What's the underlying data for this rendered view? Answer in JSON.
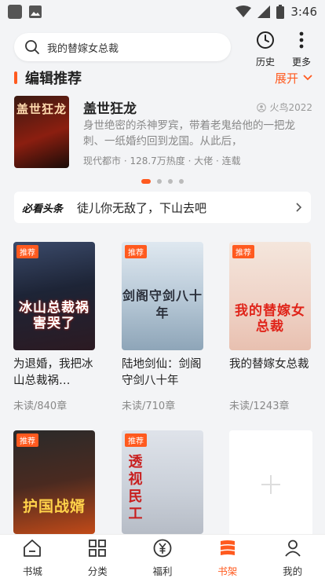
{
  "status_bar": {
    "time": "3:46"
  },
  "search": {
    "placeholder": "我的替嫁女总裁"
  },
  "top_actions": {
    "history": "历史",
    "more": "更多"
  },
  "section": {
    "title": "编辑推荐",
    "expand": "展开"
  },
  "featured": {
    "title": "盖世狂龙",
    "author": "火鸟2022",
    "description": "身世绝密的杀神罗宾，带着老鬼给他的一把龙刺、一纸婚约回到龙国。从此后，",
    "meta": "现代都市 · 128.7万热度 · 大佬 · 连载",
    "cover_text": "盖世狂龙"
  },
  "carousel": {
    "count": 4,
    "active": 0
  },
  "headline": {
    "brand": "必看头条",
    "text": "徒儿你无敌了，下山去吧"
  },
  "books": [
    {
      "title": "为退婚，我把冰山总裁祸…",
      "read": "未读/840章",
      "badge": "推荐",
      "cover_text": "冰山总裁祸害哭了"
    },
    {
      "title": "陆地剑仙：剑阁守剑八十年",
      "read": "未读/710章",
      "badge": "推荐",
      "cover_text": "剑阁守剑八十年"
    },
    {
      "title": "我的替嫁女总裁",
      "read": "未读/1243章",
      "badge": "推荐",
      "cover_text": "我的替嫁女总裁"
    },
    {
      "title": "",
      "read": "",
      "badge": "推荐",
      "cover_text": "护国战婿"
    },
    {
      "title": "",
      "read": "",
      "badge": "推荐",
      "cover_text": "透视民工"
    }
  ],
  "tabs": [
    {
      "label": "书城",
      "icon": "home-icon"
    },
    {
      "label": "分类",
      "icon": "grid-icon"
    },
    {
      "label": "福利",
      "icon": "yen-icon"
    },
    {
      "label": "书架",
      "icon": "bookshelf-icon",
      "active": true
    },
    {
      "label": "我的",
      "icon": "profile-icon"
    }
  ],
  "colors": {
    "accent": "#ff5a1f",
    "background": "#f3f4f6"
  }
}
